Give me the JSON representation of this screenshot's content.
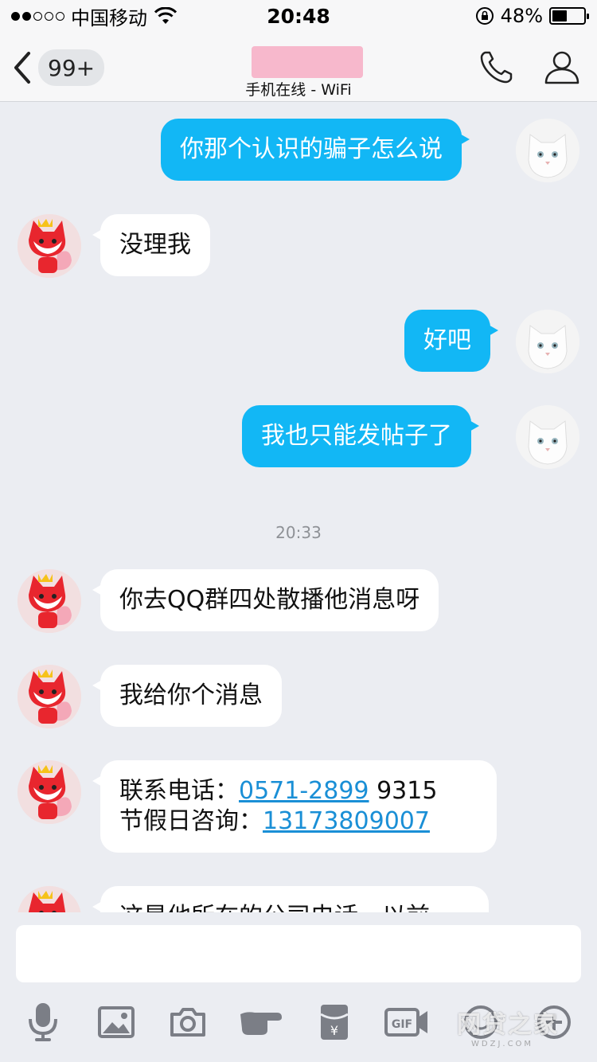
{
  "status_bar": {
    "carrier": "中国移动",
    "time": "20:48",
    "battery_percent": "48%",
    "battery_level": 0.48
  },
  "nav": {
    "unread_count": "99+",
    "subtitle": "手机在线 - WiFi"
  },
  "messages": [
    {
      "direction": "out",
      "text": "你那个认识的骗子怎么说"
    },
    {
      "direction": "in",
      "text": "没理我"
    },
    {
      "direction": "out",
      "text": "好吧"
    },
    {
      "direction": "out",
      "text": "我也只能发帖子了"
    },
    {
      "direction": "in",
      "text": "你去QQ群四处散播他消息呀"
    },
    {
      "direction": "in",
      "text": "我给你个消息"
    },
    {
      "direction": "in",
      "line1_label": "联系电话：",
      "line1_link": "0571-2899",
      "line1_rest": " 9315",
      "line2_label": "节假日咨询：",
      "line2_link": "13173809007"
    },
    {
      "direction": "in",
      "text": "这是他所在的公司电话，以前"
    }
  ],
  "timestamp": "20:33",
  "input": {
    "value": "",
    "placeholder": ""
  },
  "toolbar": [
    "mic-icon",
    "image-icon",
    "camera-icon",
    "poke-icon",
    "red-packet-icon",
    "gif-icon",
    "emoji-icon",
    "plus-icon"
  ],
  "watermark": {
    "main": "网贷之家",
    "sub": "WDZJ.COM"
  },
  "colors": {
    "outgoing_bubble": "#12b7f5",
    "incoming_bubble": "#ffffff",
    "link": "#1a8fd6",
    "background": "#ebedf2"
  }
}
